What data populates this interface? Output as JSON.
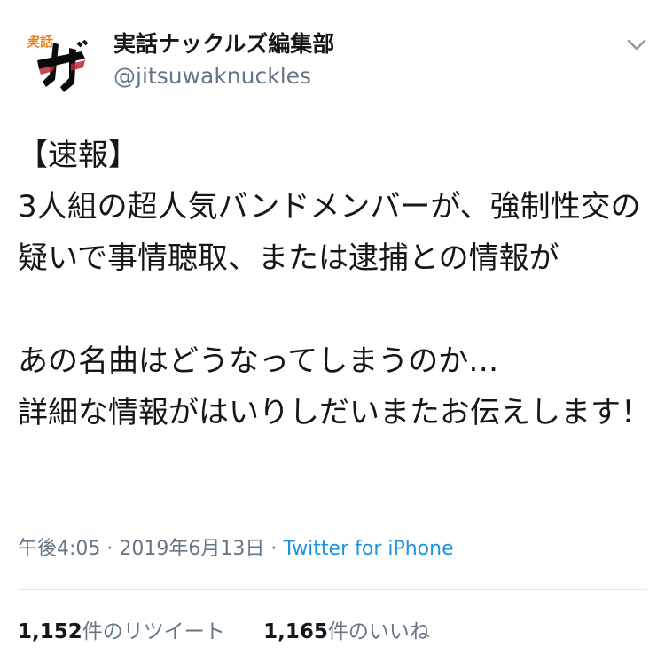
{
  "tweet": {
    "author": {
      "display_name": "実話ナックルズ編集部",
      "handle": "@jitsuwaknuckles",
      "avatar_label": "実話",
      "avatar_colors": {
        "text_orange": "#e8831f",
        "brush_black": "#0a0a0a",
        "brush_red": "#c0272d"
      }
    },
    "caret_icon": "chevron-down-icon",
    "text": "【速報】\n3人組の超人気バンドメンバーが、強制性交の疑いで事情聴取、または逮捕との情報が\n\nあの名曲はどうなってしまうのか…\n詳細な情報がはいりしだいまたお伝えします！",
    "time": "午後4:05",
    "separator": "·",
    "date": "2019年6月13日",
    "source": "Twitter for iPhone",
    "stats": {
      "retweets_count": "1,152",
      "retweets_label": "件のリツイート",
      "likes_count": "1,165",
      "likes_label": "件のいいね"
    },
    "colors": {
      "text": "#14171a",
      "secondary": "#657786",
      "link": "#1b95e0",
      "divider": "#e1e8ed"
    }
  }
}
